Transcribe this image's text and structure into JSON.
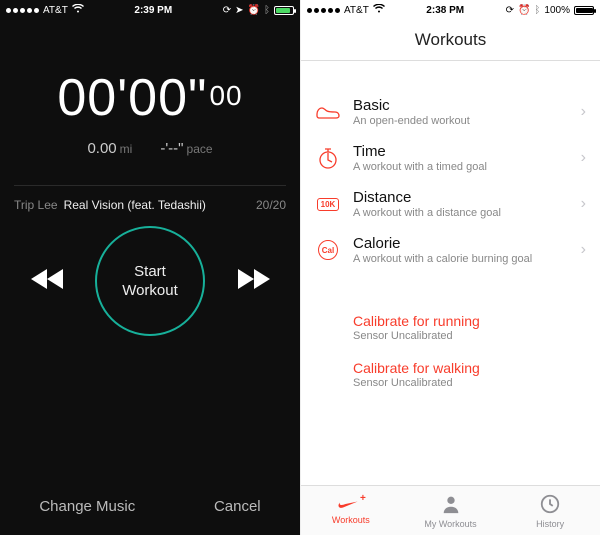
{
  "left": {
    "status": {
      "carrier": "AT&T",
      "time": "2:39 PM"
    },
    "timer_main": "00'00\"",
    "timer_sub": "00",
    "distance_value": "0.00",
    "distance_unit": "mi",
    "pace_value": "-'--\"",
    "pace_unit": "pace",
    "track": {
      "artist": "Trip Lee",
      "title": "Real Vision (feat. Tedashii)",
      "count": "20/20"
    },
    "start_label": "Start\nWorkout",
    "change_music": "Change Music",
    "cancel": "Cancel"
  },
  "right": {
    "status": {
      "carrier": "AT&T",
      "time": "2:38 PM",
      "battery": "100%"
    },
    "title": "Workouts",
    "types": [
      {
        "key": "basic",
        "title": "Basic",
        "subtitle": "An open-ended workout"
      },
      {
        "key": "time",
        "title": "Time",
        "subtitle": "A workout with a timed goal"
      },
      {
        "key": "distance",
        "title": "Distance",
        "subtitle": "A workout with a distance goal"
      },
      {
        "key": "calorie",
        "title": "Calorie",
        "subtitle": "A workout with a calorie burning goal"
      }
    ],
    "calibrate": [
      {
        "title": "Calibrate for running",
        "subtitle": "Sensor Uncalibrated"
      },
      {
        "title": "Calibrate for walking",
        "subtitle": "Sensor Uncalibrated"
      }
    ],
    "tabs": {
      "workouts": "Workouts",
      "my": "My Workouts",
      "history": "History"
    }
  }
}
